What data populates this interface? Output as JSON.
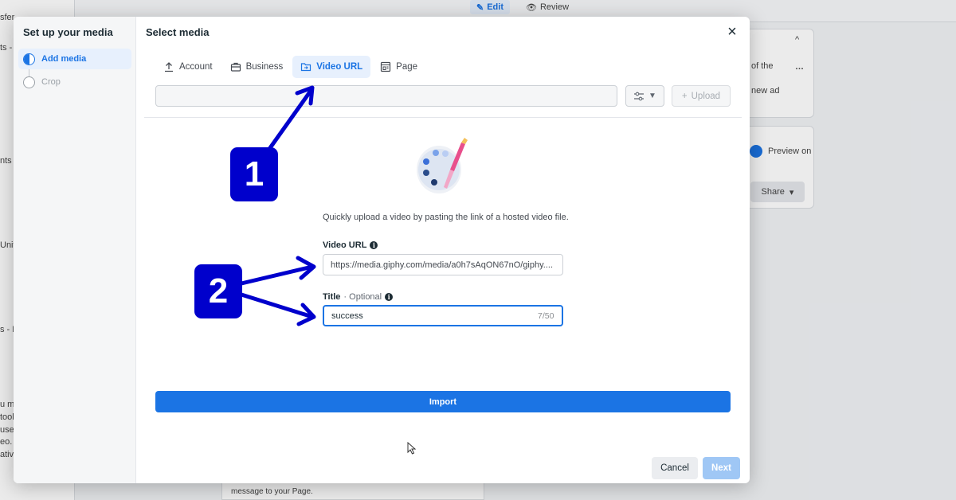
{
  "background": {
    "left_fragments": [
      "sfer",
      "ts -",
      "nts -",
      "Univ",
      "s - M",
      "u mi",
      "tool",
      "use",
      "eo.",
      "ativ"
    ],
    "top_tabs": {
      "edit": "Edit",
      "review": "Review"
    },
    "right_texts": [
      "of the",
      "new ad",
      "Preview on",
      "Share"
    ],
    "bottom_text": "message to your Page."
  },
  "dialog": {
    "steps_title": "Set up your media",
    "steps": [
      {
        "label": "Add media",
        "state": "active"
      },
      {
        "label": "Crop",
        "state": "inactive"
      }
    ],
    "title": "Select media",
    "close_label": "×",
    "tabs": [
      {
        "label": "Account",
        "icon": "upload-icon",
        "active": false
      },
      {
        "label": "Business",
        "icon": "briefcase-icon",
        "active": false
      },
      {
        "label": "Video URL",
        "icon": "folder-link-icon",
        "active": true
      },
      {
        "label": "Page",
        "icon": "page-icon",
        "active": false
      }
    ],
    "search_value": "",
    "upload_label": "Upload",
    "description": "Quickly upload a video by pasting the link of a hosted video file.",
    "video_url": {
      "label": "Video URL",
      "value": "https://media.giphy.com/media/a0h7sAqON67nO/giphy...."
    },
    "title_field": {
      "label": "Title",
      "optional": "· Optional",
      "value": "success",
      "counter": "7/50"
    },
    "import_label": "Import",
    "cancel_label": "Cancel",
    "next_label": "Next"
  },
  "annotations": {
    "badge_1": "1",
    "badge_2": "2",
    "color": "#0000cc"
  },
  "colors": {
    "accent": "#1b74e4",
    "accent_light": "#e7f0fd",
    "disabled_next": "#9fc7f5"
  }
}
